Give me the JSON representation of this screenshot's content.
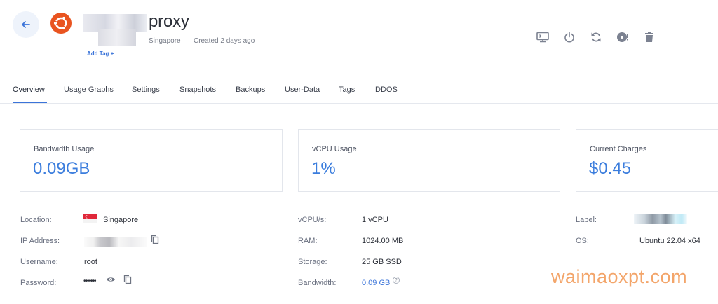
{
  "header": {
    "server_name": "proxy",
    "location": "Singapore",
    "created": "Created 2 days ago",
    "add_tag": "Add Tag +"
  },
  "toolbar": {
    "icons": [
      "console-icon",
      "power-icon",
      "restart-icon",
      "iso-icon",
      "trash-icon"
    ]
  },
  "tabs": [
    "Overview",
    "Usage Graphs",
    "Settings",
    "Snapshots",
    "Backups",
    "User-Data",
    "Tags",
    "DDOS"
  ],
  "active_tab": "Overview",
  "cards": {
    "bandwidth": {
      "label": "Bandwidth Usage",
      "value": "0.09GB"
    },
    "vcpu": {
      "label": "vCPU Usage",
      "value": "1%"
    },
    "charges": {
      "label": "Current Charges",
      "value": "$0.45"
    }
  },
  "details": {
    "location_label": "Location:",
    "location_value": "Singapore",
    "ip_label": "IP Address:",
    "username_label": "Username:",
    "username_value": "root",
    "password_label": "Password:",
    "password_value": "•••••••",
    "vcpus_label": "vCPU/s:",
    "vcpus_value": "1 vCPU",
    "ram_label": "RAM:",
    "ram_value": "1024.00 MB",
    "storage_label": "Storage:",
    "storage_value": "25 GB SSD",
    "bandwidth_label": "Bandwidth:",
    "bandwidth_value": "0.09 GB",
    "label_label": "Label:",
    "os_label": "OS:",
    "os_value": "Ubuntu 22.04 x64"
  },
  "watermark": "waimaoxpt.com",
  "colors": {
    "accent": "#3b74d9",
    "value_blue": "#3b7ddd",
    "ubuntu": "#e95420",
    "watermark": "#f3a56a"
  }
}
